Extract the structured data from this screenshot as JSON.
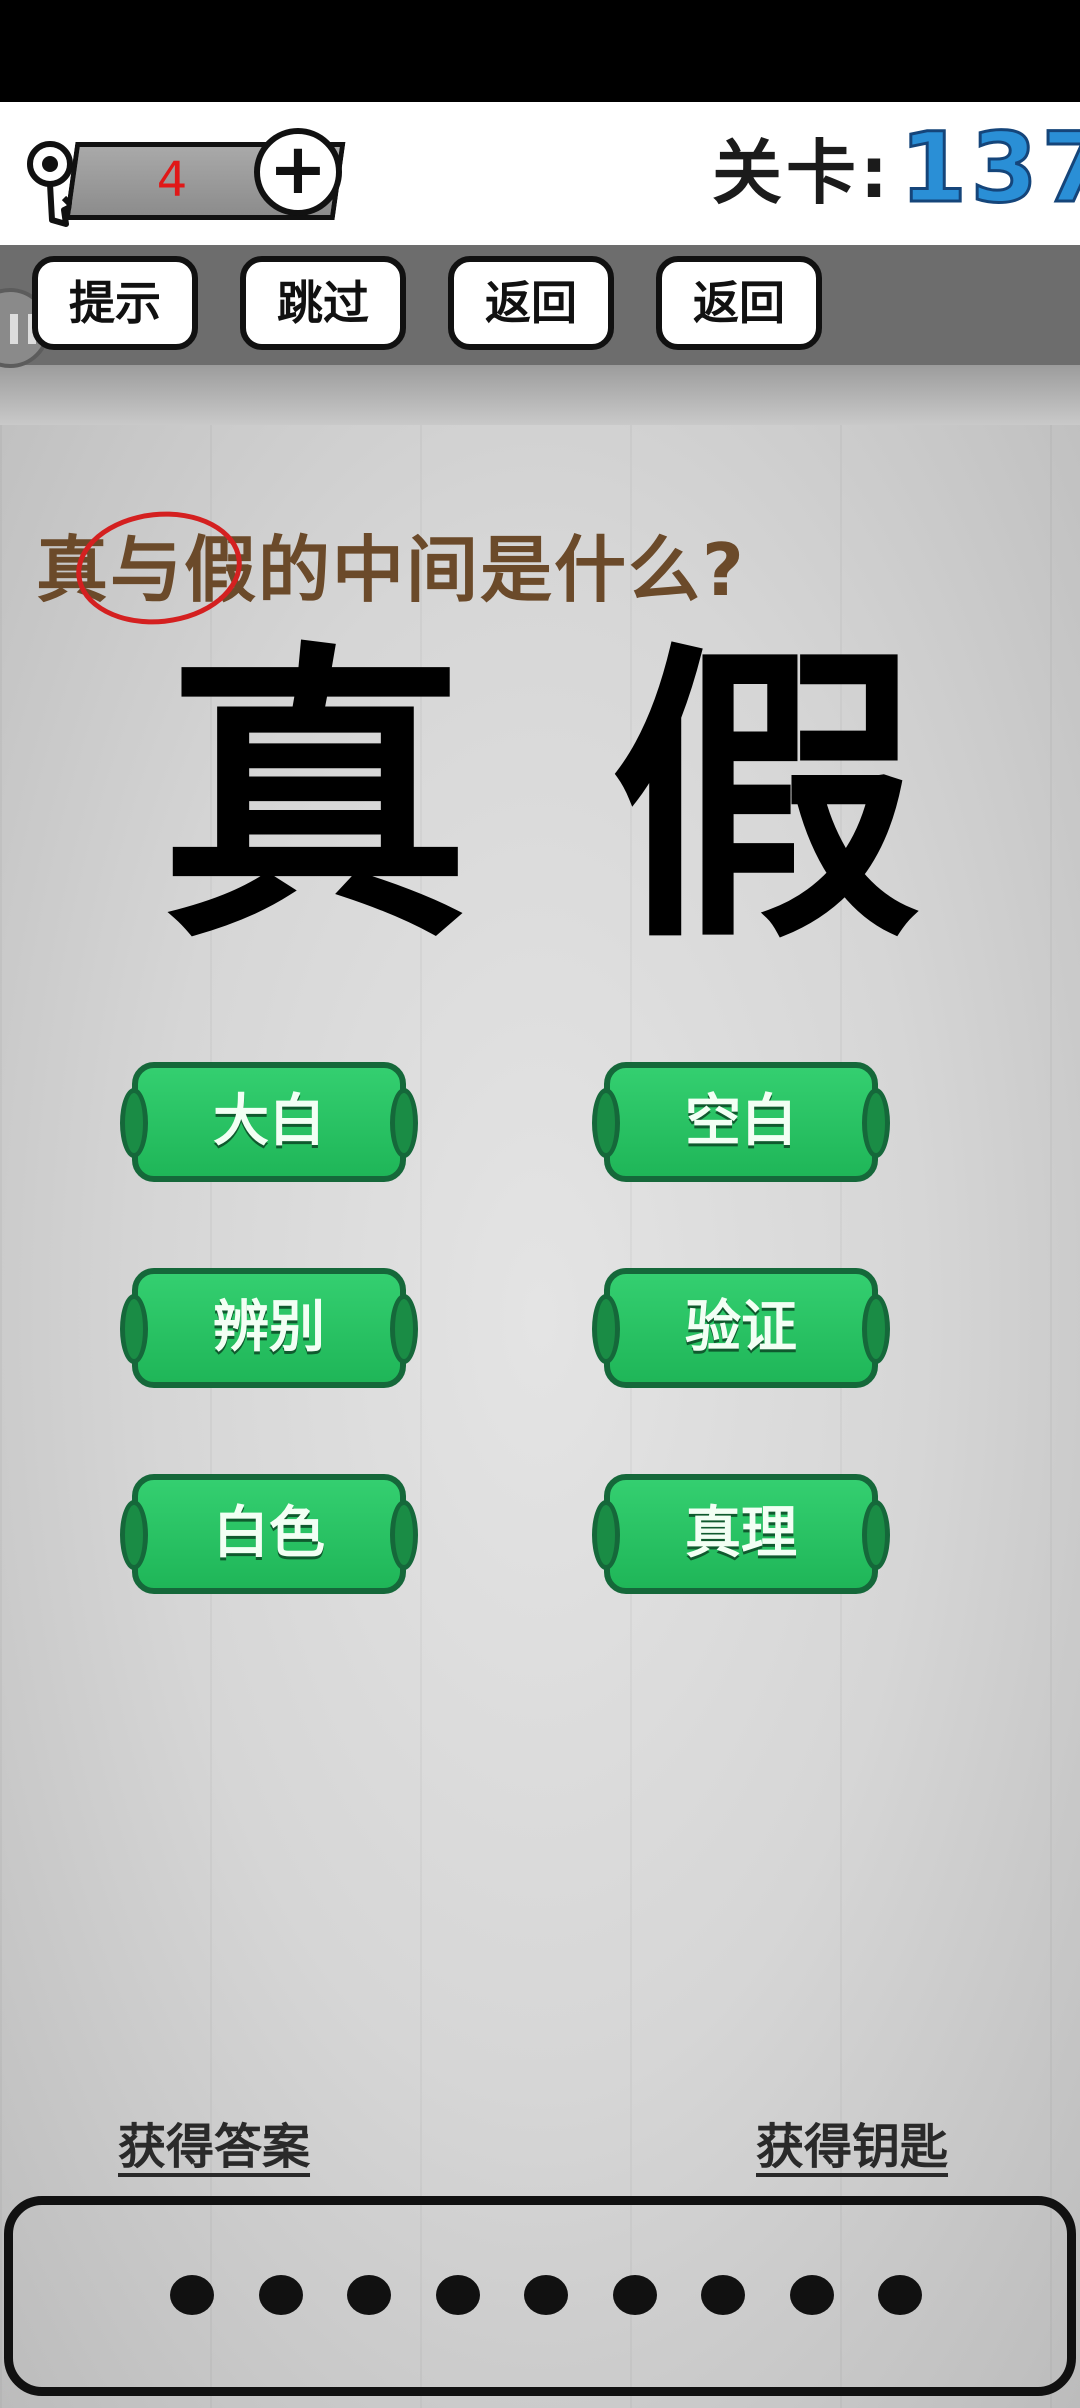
{
  "header": {
    "key_count": "4",
    "plus_label": "+",
    "level_label": "关卡:",
    "level_number": "137"
  },
  "toolbar": {
    "buttons": [
      "提示",
      "跳过",
      "返回",
      "返回"
    ]
  },
  "puzzle": {
    "question": "真与假的中间是什么?",
    "chars": [
      "真",
      "假"
    ]
  },
  "options": [
    "大白",
    "空白",
    "辨别",
    "验证",
    "白色",
    "真理"
  ],
  "footer": {
    "get_answer": "获得答案",
    "get_key": "获得钥匙",
    "answer_slots": 9
  },
  "colors": {
    "option_green": "#28c263",
    "level_blue": "#2a8fd6",
    "question_brown": "#6b4a2a",
    "key_count_red": "#e01818"
  }
}
